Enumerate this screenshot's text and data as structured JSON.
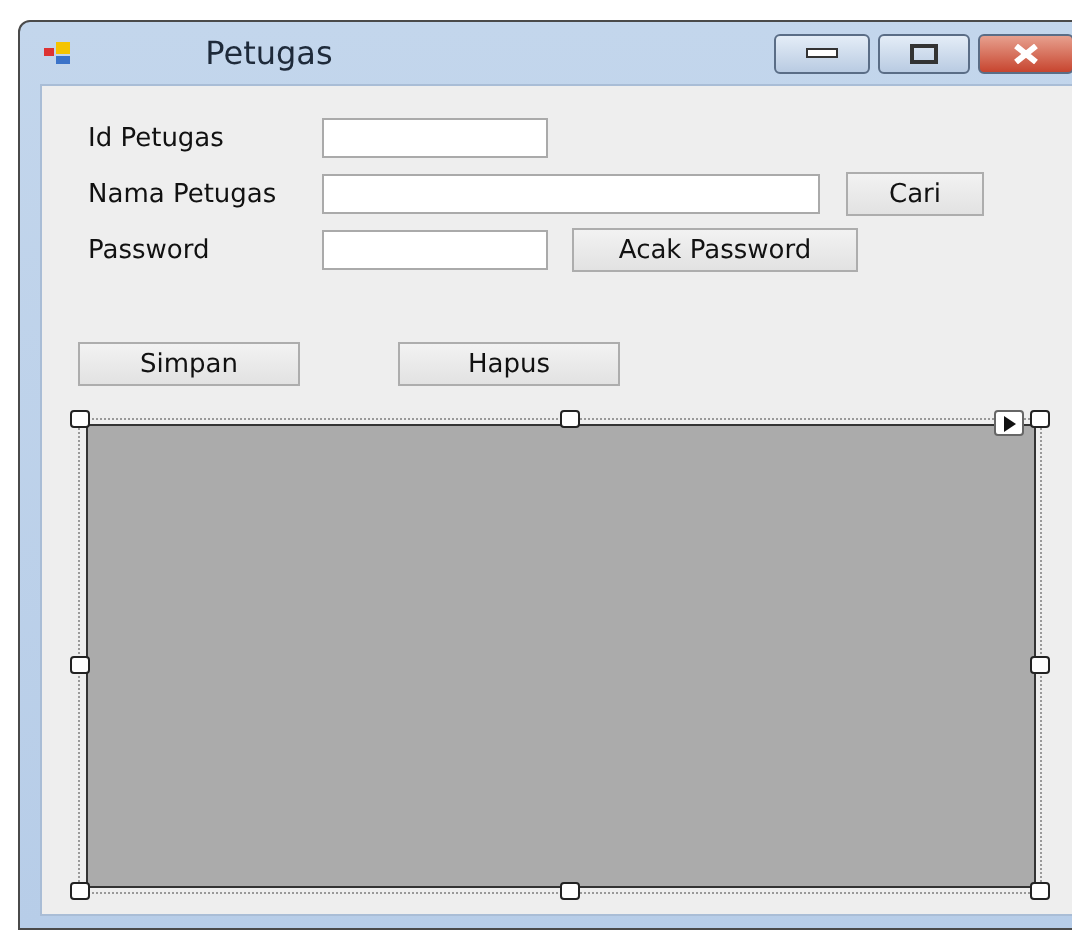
{
  "window": {
    "title": "Petugas"
  },
  "fields": [
    {
      "label": "Id Petugas",
      "kind": "short"
    },
    {
      "label": "Nama Petugas",
      "kind": "long",
      "button": "Cari"
    },
    {
      "label": "Password",
      "kind": "short",
      "button": "Acak Password"
    }
  ],
  "actions": [
    "Simpan",
    "Hapus"
  ],
  "data_grid": {
    "selected": true
  }
}
